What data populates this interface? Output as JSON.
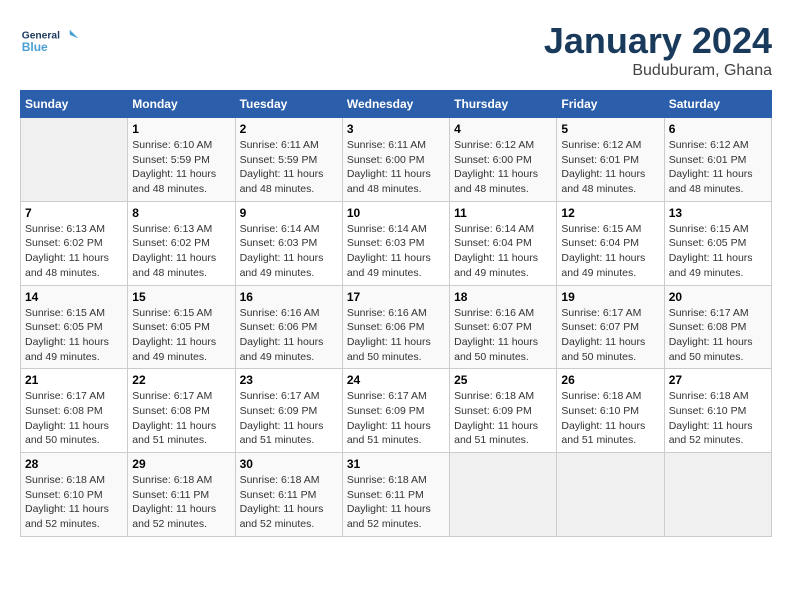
{
  "header": {
    "logo_line1": "General",
    "logo_line2": "Blue",
    "month": "January 2024",
    "location": "Buduburam, Ghana"
  },
  "weekdays": [
    "Sunday",
    "Monday",
    "Tuesday",
    "Wednesday",
    "Thursday",
    "Friday",
    "Saturday"
  ],
  "weeks": [
    [
      {
        "day": "",
        "info": ""
      },
      {
        "day": "1",
        "info": "Sunrise: 6:10 AM\nSunset: 5:59 PM\nDaylight: 11 hours and 48 minutes."
      },
      {
        "day": "2",
        "info": "Sunrise: 6:11 AM\nSunset: 5:59 PM\nDaylight: 11 hours and 48 minutes."
      },
      {
        "day": "3",
        "info": "Sunrise: 6:11 AM\nSunset: 6:00 PM\nDaylight: 11 hours and 48 minutes."
      },
      {
        "day": "4",
        "info": "Sunrise: 6:12 AM\nSunset: 6:00 PM\nDaylight: 11 hours and 48 minutes."
      },
      {
        "day": "5",
        "info": "Sunrise: 6:12 AM\nSunset: 6:01 PM\nDaylight: 11 hours and 48 minutes."
      },
      {
        "day": "6",
        "info": "Sunrise: 6:12 AM\nSunset: 6:01 PM\nDaylight: 11 hours and 48 minutes."
      }
    ],
    [
      {
        "day": "7",
        "info": "Sunrise: 6:13 AM\nSunset: 6:02 PM\nDaylight: 11 hours and 48 minutes."
      },
      {
        "day": "8",
        "info": "Sunrise: 6:13 AM\nSunset: 6:02 PM\nDaylight: 11 hours and 48 minutes."
      },
      {
        "day": "9",
        "info": "Sunrise: 6:14 AM\nSunset: 6:03 PM\nDaylight: 11 hours and 49 minutes."
      },
      {
        "day": "10",
        "info": "Sunrise: 6:14 AM\nSunset: 6:03 PM\nDaylight: 11 hours and 49 minutes."
      },
      {
        "day": "11",
        "info": "Sunrise: 6:14 AM\nSunset: 6:04 PM\nDaylight: 11 hours and 49 minutes."
      },
      {
        "day": "12",
        "info": "Sunrise: 6:15 AM\nSunset: 6:04 PM\nDaylight: 11 hours and 49 minutes."
      },
      {
        "day": "13",
        "info": "Sunrise: 6:15 AM\nSunset: 6:05 PM\nDaylight: 11 hours and 49 minutes."
      }
    ],
    [
      {
        "day": "14",
        "info": "Sunrise: 6:15 AM\nSunset: 6:05 PM\nDaylight: 11 hours and 49 minutes."
      },
      {
        "day": "15",
        "info": "Sunrise: 6:15 AM\nSunset: 6:05 PM\nDaylight: 11 hours and 49 minutes."
      },
      {
        "day": "16",
        "info": "Sunrise: 6:16 AM\nSunset: 6:06 PM\nDaylight: 11 hours and 49 minutes."
      },
      {
        "day": "17",
        "info": "Sunrise: 6:16 AM\nSunset: 6:06 PM\nDaylight: 11 hours and 50 minutes."
      },
      {
        "day": "18",
        "info": "Sunrise: 6:16 AM\nSunset: 6:07 PM\nDaylight: 11 hours and 50 minutes."
      },
      {
        "day": "19",
        "info": "Sunrise: 6:17 AM\nSunset: 6:07 PM\nDaylight: 11 hours and 50 minutes."
      },
      {
        "day": "20",
        "info": "Sunrise: 6:17 AM\nSunset: 6:08 PM\nDaylight: 11 hours and 50 minutes."
      }
    ],
    [
      {
        "day": "21",
        "info": "Sunrise: 6:17 AM\nSunset: 6:08 PM\nDaylight: 11 hours and 50 minutes."
      },
      {
        "day": "22",
        "info": "Sunrise: 6:17 AM\nSunset: 6:08 PM\nDaylight: 11 hours and 51 minutes."
      },
      {
        "day": "23",
        "info": "Sunrise: 6:17 AM\nSunset: 6:09 PM\nDaylight: 11 hours and 51 minutes."
      },
      {
        "day": "24",
        "info": "Sunrise: 6:17 AM\nSunset: 6:09 PM\nDaylight: 11 hours and 51 minutes."
      },
      {
        "day": "25",
        "info": "Sunrise: 6:18 AM\nSunset: 6:09 PM\nDaylight: 11 hours and 51 minutes."
      },
      {
        "day": "26",
        "info": "Sunrise: 6:18 AM\nSunset: 6:10 PM\nDaylight: 11 hours and 51 minutes."
      },
      {
        "day": "27",
        "info": "Sunrise: 6:18 AM\nSunset: 6:10 PM\nDaylight: 11 hours and 52 minutes."
      }
    ],
    [
      {
        "day": "28",
        "info": "Sunrise: 6:18 AM\nSunset: 6:10 PM\nDaylight: 11 hours and 52 minutes."
      },
      {
        "day": "29",
        "info": "Sunrise: 6:18 AM\nSunset: 6:11 PM\nDaylight: 11 hours and 52 minutes."
      },
      {
        "day": "30",
        "info": "Sunrise: 6:18 AM\nSunset: 6:11 PM\nDaylight: 11 hours and 52 minutes."
      },
      {
        "day": "31",
        "info": "Sunrise: 6:18 AM\nSunset: 6:11 PM\nDaylight: 11 hours and 52 minutes."
      },
      {
        "day": "",
        "info": ""
      },
      {
        "day": "",
        "info": ""
      },
      {
        "day": "",
        "info": ""
      }
    ]
  ]
}
